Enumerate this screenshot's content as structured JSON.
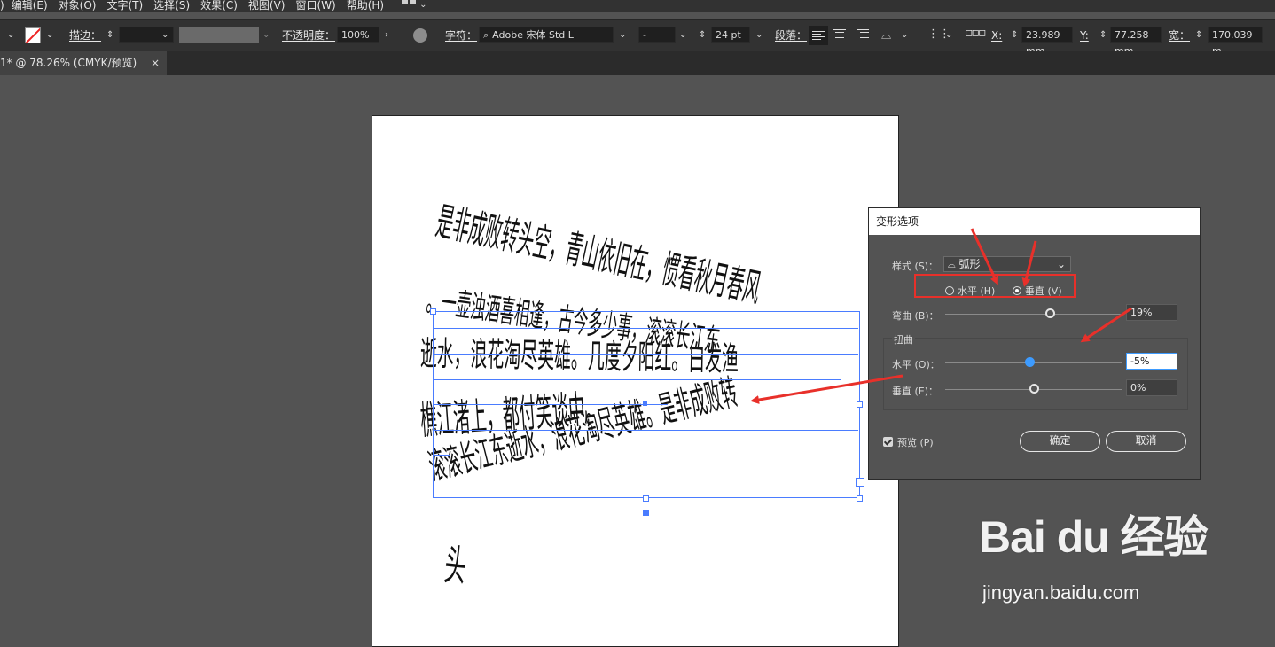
{
  "menu": {
    "items": [
      "编辑(E)",
      "对象(O)",
      "文字(T)",
      "选择(S)",
      "效果(C)",
      "视图(V)",
      "窗口(W)",
      "帮助(H)"
    ]
  },
  "controlbar": {
    "stroke_label": "描边：",
    "opacity_label": "不透明度：",
    "opacity_value": "100%",
    "char_label": "字符：",
    "font_name": "Adobe 宋体 Std L",
    "font_style": "-",
    "font_size": "24 pt",
    "para_label": "段落：",
    "x_label": "X:",
    "x_value": "23.989 mm",
    "y_label": "Y:",
    "y_value": "77.258 mm",
    "w_label": "宽：",
    "w_value": "170.039 m"
  },
  "tab": {
    "title": "1* @ 78.26% (CMYK/预览)",
    "close": "×"
  },
  "artboard": {
    "lines": [
      "是非成败转头空，青山依旧在，惯看秋月春风",
      "。一壶浊酒喜相逢，古今多少事，滚滚长江东",
      "逝水，浪花淘尽英雄。几度夕阳红。白发渔",
      "樵江渚上，都付笑谈中。",
      "滚滚长江东逝水，浪花淘尽英雄。是非成败转",
      "头"
    ]
  },
  "dialog": {
    "title": "变形选项",
    "style_label": "样式 (S)：",
    "style_value": "弧形",
    "horizontal_label": "水平 (H)",
    "vertical_label": "垂直 (V)",
    "orientation_selected": "垂直",
    "bend_label": "弯曲 (B)：",
    "bend_value": "19%",
    "bend_fraction": 0.59,
    "distortion_label": "扭曲",
    "dist_h_label": "水平 (O)：",
    "dist_h_value": "-5%",
    "dist_h_fraction": 0.475,
    "dist_v_label": "垂直 (E)：",
    "dist_v_value": "0%",
    "dist_v_fraction": 0.5,
    "preview_label": "预览 (P)",
    "ok_label": "确定",
    "cancel_label": "取消"
  },
  "watermark": {
    "brand": "Bai du 经验",
    "url": "jingyan.baidu.com"
  },
  "colors": {
    "annotation_red": "#e8302a",
    "selection_blue": "#4a7cff",
    "slider_active": "#3d9bff"
  }
}
